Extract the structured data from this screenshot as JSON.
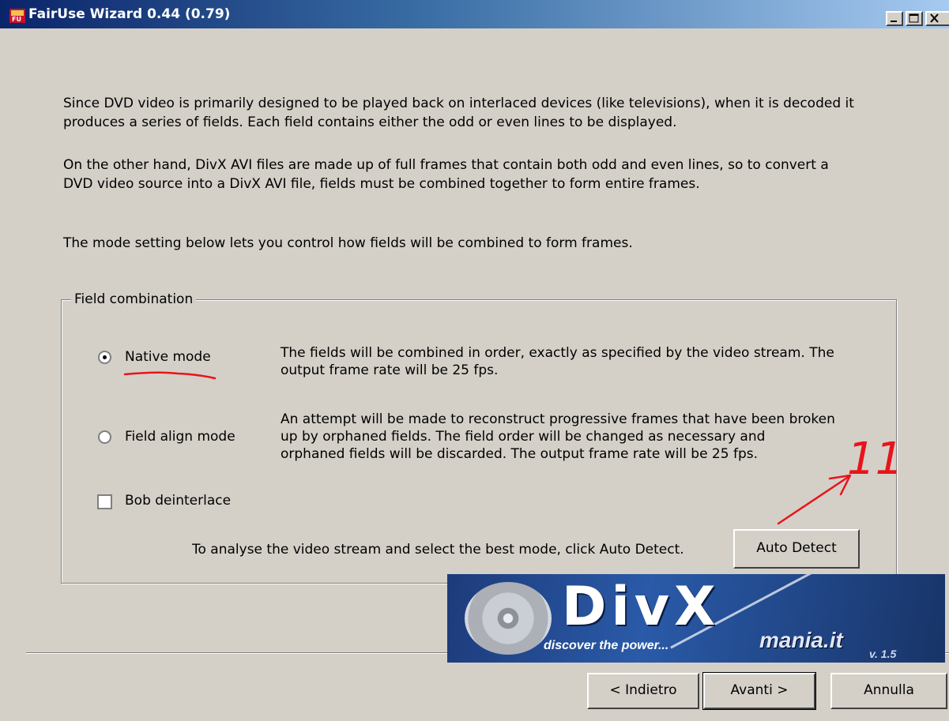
{
  "window": {
    "title": "FairUse Wizard 0.44 (0.79)"
  },
  "intro": {
    "para1_line1": "Since DVD video is primarily designed to be played back on interlaced devices (like televisions), when it is decoded it",
    "para1_line2": "produces a series of fields. Each field contains either the odd or even lines to be displayed.",
    "para2_line1": "On the other hand, DivX AVI files are made up of full frames that contain both odd and even lines, so to convert a",
    "para2_line2": "DVD video source into a DivX AVI file, fields must be combined together to form entire frames.",
    "para3": "The mode setting below lets you control how fields will be combined to form frames."
  },
  "field_combination": {
    "legend": "Field combination",
    "native": {
      "label": "Native mode",
      "checked": true,
      "desc_line1": "The fields will be combined in order, exactly as specified by the video stream. The",
      "desc_line2": "output frame rate will be 25 fps."
    },
    "field_align": {
      "label": "Field align mode",
      "checked": false,
      "desc_line1": "An attempt will be made to reconstruct progressive frames that have been broken",
      "desc_line2": "up by orphaned fields. The field order will be changed as necessary and",
      "desc_line3": "orphaned fields will be discarded. The output frame rate will be 25 fps."
    },
    "bob": {
      "label": "Bob deinterlace",
      "checked": false
    },
    "auto_detect_hint": "To analyse the video stream and select the best mode, click Auto Detect.",
    "auto_detect_button": "Auto Detect"
  },
  "banner": {
    "logo_text": "DivX",
    "tagline": "discover the power...",
    "site": "mania.it",
    "version": "v. 1.5"
  },
  "annotation": {
    "text": "11",
    "color": "#e8141b"
  },
  "footer": {
    "back": "< Indietro",
    "next": "Avanti >",
    "cancel": "Annulla"
  }
}
